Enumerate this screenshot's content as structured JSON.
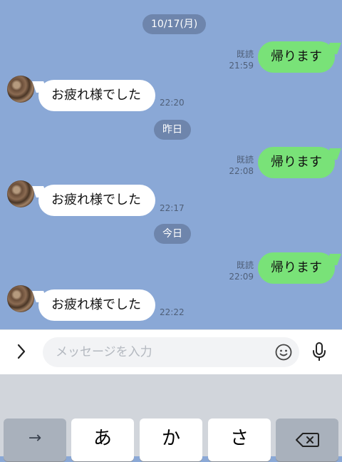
{
  "chat": {
    "date_labels": [
      "10/17(月)",
      "昨日",
      "今日"
    ],
    "messages": [
      {
        "direction": "out",
        "text": "帰ります",
        "read": "既読",
        "time": "21:59"
      },
      {
        "direction": "in",
        "text": "お疲れ様でした",
        "time": "22:20"
      },
      {
        "direction": "out",
        "text": "帰ります",
        "read": "既読",
        "time": "22:08"
      },
      {
        "direction": "in",
        "text": "お疲れ様でした",
        "time": "22:17"
      },
      {
        "direction": "out",
        "text": "帰ります",
        "read": "既読",
        "time": "22:09"
      },
      {
        "direction": "in",
        "text": "お疲れ様でした",
        "time": "22:22"
      }
    ]
  },
  "composer": {
    "placeholder": "メッセージを入力",
    "expand_icon": "chevron-right-icon",
    "emoji_icon": "smiley-icon",
    "mic_icon": "microphone-icon"
  },
  "keyboard": {
    "keys": [
      "→",
      "あ",
      "か",
      "さ",
      "⌫"
    ]
  },
  "colors": {
    "chat_background": "#8aa8d6",
    "outgoing_bubble": "#79e278",
    "incoming_bubble": "#ffffff"
  }
}
